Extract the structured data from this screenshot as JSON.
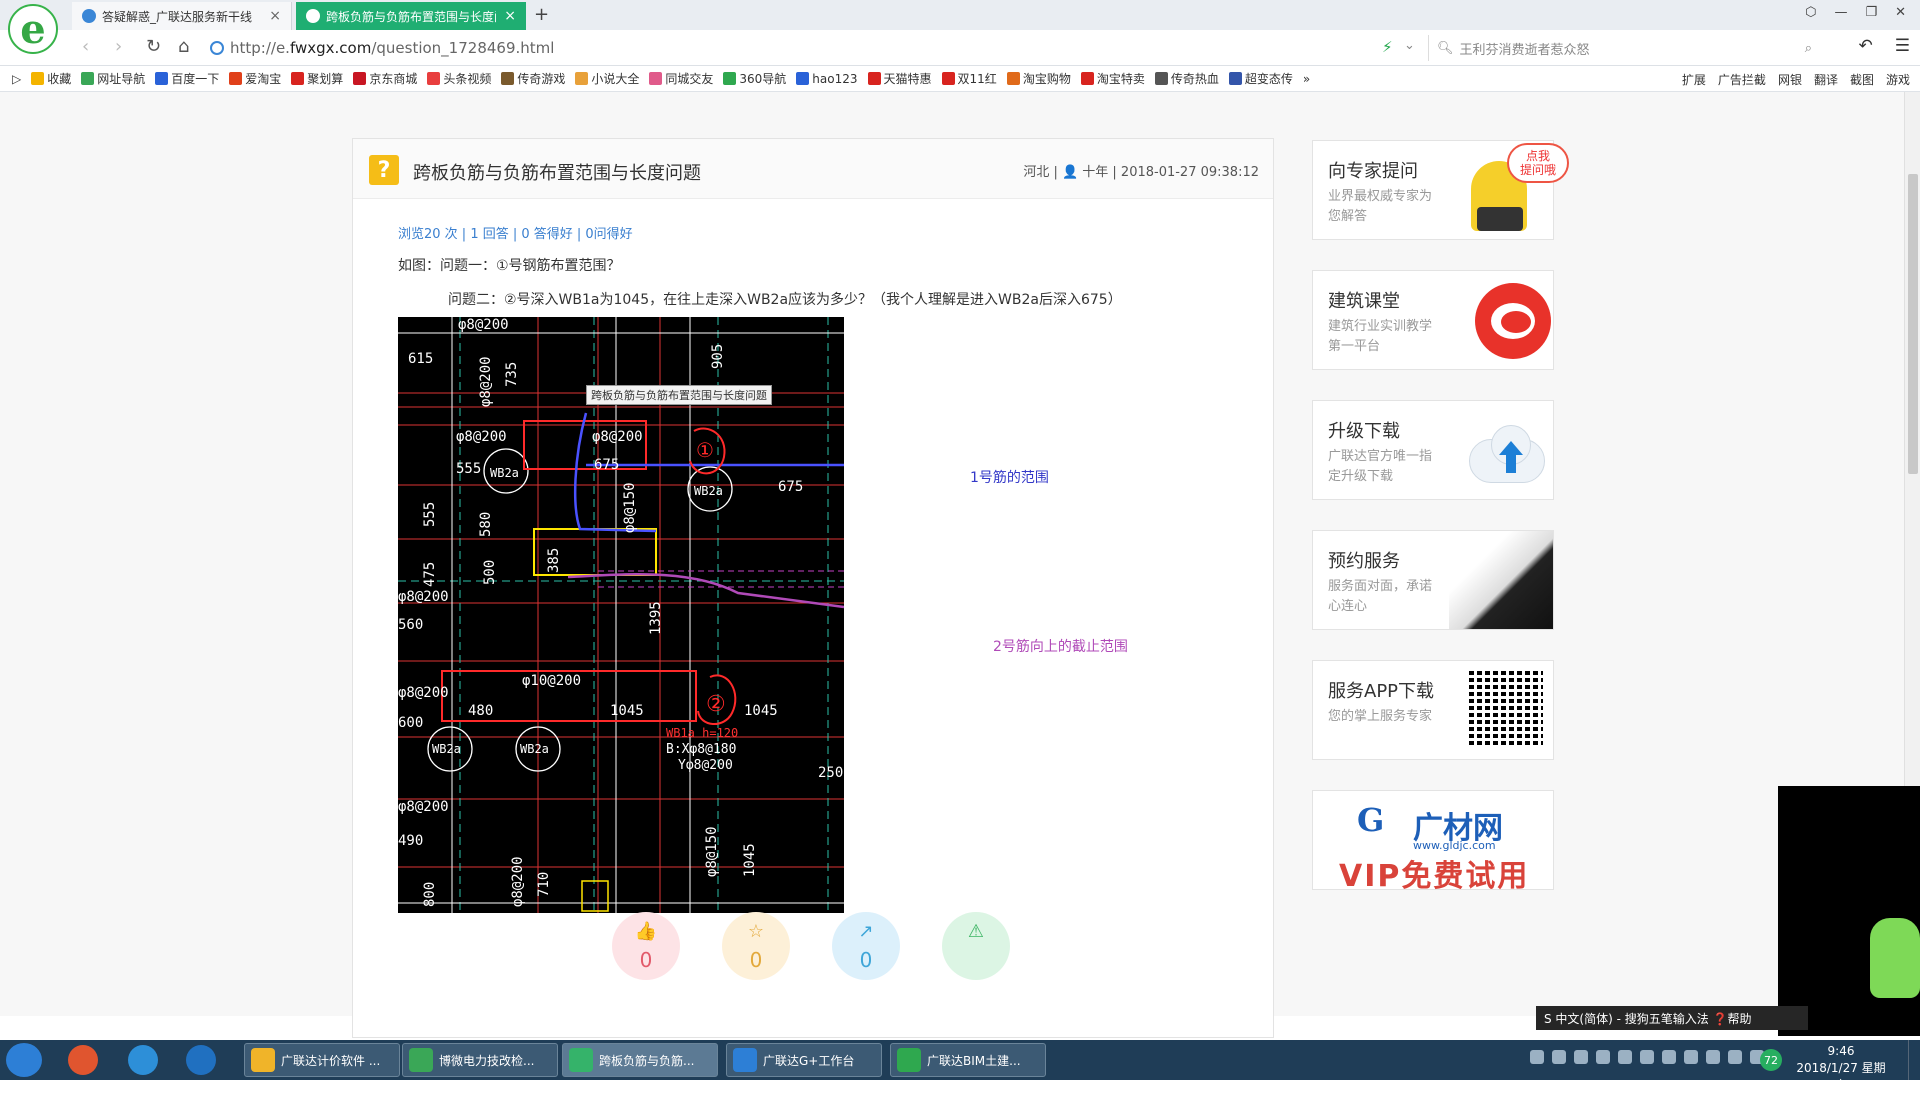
{
  "tabs": [
    {
      "label": "答疑解惑_广联达服务新干线",
      "close": "×"
    },
    {
      "label": "跨板负筋与负筋布置范围与长度问题",
      "close": "×"
    }
  ],
  "new_tab": "+",
  "address": {
    "url_prefix": "http://e.",
    "url_domain": "fwxgx.com",
    "url_path": "/question_1728469.html",
    "search_placeholder": "王利芬消费逝者惹众怒"
  },
  "bookmarks": [
    {
      "label": "收藏",
      "color": "#f4b400"
    },
    {
      "label": "网址导航",
      "color": "#3aa757"
    },
    {
      "label": "百度一下",
      "color": "#2a62d8"
    },
    {
      "label": "爱淘宝",
      "color": "#e0401a"
    },
    {
      "label": "聚划算",
      "color": "#d8241f"
    },
    {
      "label": "京东商城",
      "color": "#c81623"
    },
    {
      "label": "头条视频",
      "color": "#e83e3e"
    },
    {
      "label": "传奇游戏",
      "color": "#7a5a2d"
    },
    {
      "label": "小说大全",
      "color": "#e8a13a"
    },
    {
      "label": "同城交友",
      "color": "#e05a8a"
    },
    {
      "label": "360导航",
      "color": "#2fa84f"
    },
    {
      "label": "hao123",
      "color": "#2a62d8"
    },
    {
      "label": "天猫特惠",
      "color": "#d8241f"
    },
    {
      "label": "双11红",
      "color": "#d8241f"
    },
    {
      "label": "淘宝购物",
      "color": "#e06a1a"
    },
    {
      "label": "淘宝特卖",
      "color": "#d8241f"
    },
    {
      "label": "传奇热血",
      "color": "#555555"
    },
    {
      "label": "超变态传",
      "color": "#3355aa"
    }
  ],
  "bookmarks_more": "»",
  "toolbar_right": [
    "扩展",
    "广告拦截",
    "网银",
    "翻译",
    "截图",
    "游戏"
  ],
  "question": {
    "badge": "?",
    "title": "跨板负筋与负筋布置范围与长度问题",
    "meta": "河北 | 👤 十年 | 2018-01-27 09:38:12",
    "stats": "浏览20 次 | 1 回答 | 0 答得好 | 0问得好",
    "line1": "如图：问题一：①号钢筋布置范围？",
    "line2": "问题二：②号深入WB1a为1045，在往上走深入WB2a应该为多少？（我个人理解是进入WB2a后深入675）",
    "image_tooltip": "跨板负筋与负筋布置范围与长度问题",
    "annotation_1": "1号筋的范围",
    "annotation_2": "2号筋向上的截止范围"
  },
  "cad_labels": {
    "t1": "φ8@200",
    "t2": "615",
    "t3": "φ8@200",
    "t4": "735",
    "t5": "905",
    "t6": "φ8@200",
    "t7": "555",
    "t8": "WB2a",
    "t9": "φ8@200",
    "t10": "675",
    "t11": "675",
    "t12": "WB2a",
    "t13": "580",
    "t14": "555",
    "t15": "475",
    "t16": "500",
    "t17": "385",
    "t18": "φ8@150",
    "t19": "1395",
    "t20": "φ10@200",
    "t21": "480",
    "t22": "1045",
    "t23": "1045",
    "t24": "WB1a h=120",
    "t25": "B:Xφ8@180",
    "t26": "Yφ8@200",
    "t27": "WB2a",
    "t28": "WB2a",
    "t29": "250",
    "t30": "φ8@200",
    "t31": "φ8@150",
    "t32": "1045",
    "t33": "710",
    "t34": "φ8@200",
    "t35": "800",
    "t36": "490",
    "t37": "600",
    "t38": "φ8@200",
    "t39": "560",
    "t40": "φ8@200",
    "t41": "①",
    "t42": "②"
  },
  "reactions": [
    {
      "icon": "👍",
      "count": "0",
      "bg": "#fde3e6",
      "color": "#e25a6a"
    },
    {
      "icon": "☆",
      "count": "0",
      "bg": "#fdf0d8",
      "color": "#e3a93b"
    },
    {
      "icon": "↗",
      "count": "0",
      "bg": "#dcf0fb",
      "color": "#3fa6d8"
    },
    {
      "icon": "⚠",
      "count": "",
      "bg": "#dcf5e4",
      "color": "#3db564"
    }
  ],
  "sidebar": [
    {
      "title": "向专家提问",
      "desc": "业界最权威专家为您解答",
      "bubble": "点我\n提问哦"
    },
    {
      "title": "建筑课堂",
      "desc": "建筑行业实训教学第一平台"
    },
    {
      "title": "升级下载",
      "desc": "广联达官方唯一指定升级下载"
    },
    {
      "title": "预约服务",
      "desc": "服务面对面，承诺心连心"
    },
    {
      "title": "服务APP下载",
      "desc": "您的掌上服务专家"
    }
  ],
  "vip": {
    "logo": "G",
    "name": "广材网",
    "site": "www.gldjc.com",
    "text": "VIP免费试用"
  },
  "ime": "S 中文(简体) - 搜狗五笔输入法  ❓帮助",
  "taskbar": [
    {
      "label": "广联达计价软件 ...",
      "color": "#f0b429"
    },
    {
      "label": "博微电力技改检...",
      "color": "#3aa757"
    },
    {
      "label": "跨板负筋与负筋...",
      "color": "#35b36a"
    },
    {
      "label": "广联达G+工作台",
      "color": "#2d7fd6"
    },
    {
      "label": "广联达BIM土建...",
      "color": "#2fa84f"
    }
  ],
  "tray_count": "72",
  "clock": {
    "time": "9:46",
    "date": "2018/1/27 星期六"
  }
}
